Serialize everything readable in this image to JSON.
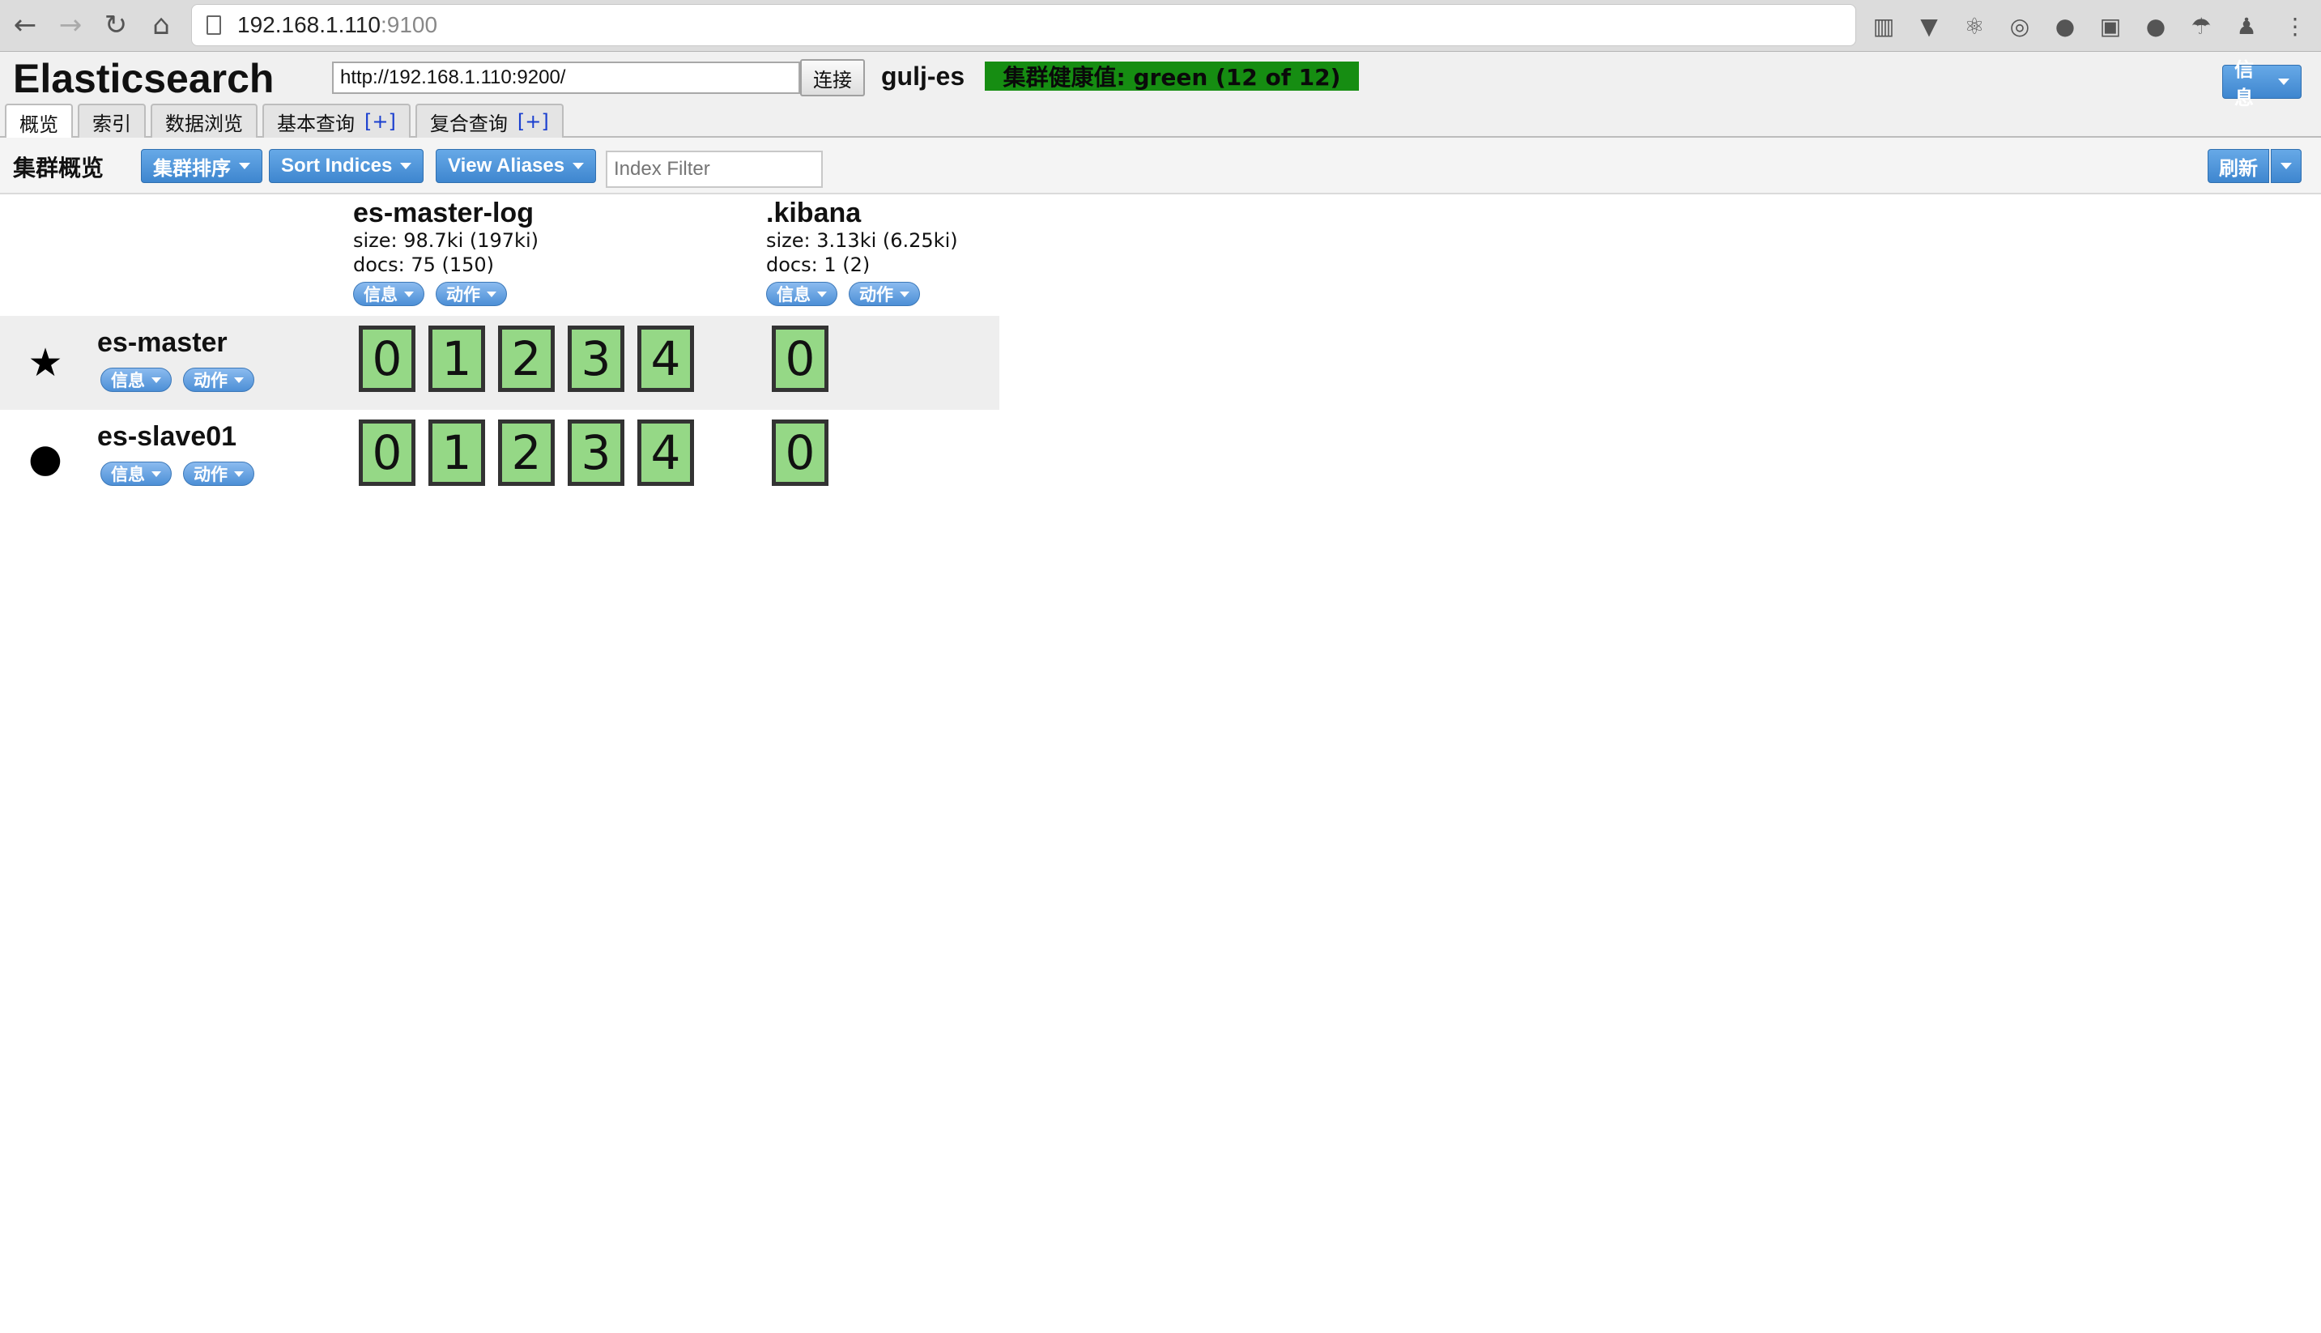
{
  "browser": {
    "url_host": "192.168.1.110",
    "url_port": ":9100"
  },
  "header": {
    "title": "Elasticsearch",
    "connect_url": "http://192.168.1.110:9200/",
    "connect_label": "连接",
    "cluster_name": "gulj-es",
    "health_text": "集群健康值: green (12 of 12)",
    "health_color": "#168d12",
    "info_label": "信息"
  },
  "tabs": [
    {
      "label": "概览",
      "plus": ""
    },
    {
      "label": "索引",
      "plus": ""
    },
    {
      "label": "数据浏览",
      "plus": ""
    },
    {
      "label": "基本查询",
      "plus": "[+]"
    },
    {
      "label": "复合查询",
      "plus": "[+]"
    }
  ],
  "toolbar": {
    "title": "集群概览",
    "sort_cluster": "集群排序",
    "sort_indices": "Sort Indices",
    "view_aliases": "View Aliases",
    "filter_placeholder": "Index Filter",
    "refresh": "刷新"
  },
  "indices": [
    {
      "name": "es-master-log",
      "size": "size: 98.7ki (197ki)",
      "docs": "docs: 75 (150)",
      "info": "信息",
      "action": "动作"
    },
    {
      "name": ".kibana",
      "size": "size: 3.13ki (6.25ki)",
      "docs": "docs: 1 (2)",
      "info": "信息",
      "action": "动作"
    }
  ],
  "nodes": [
    {
      "name": "es-master",
      "icon": "star-icon",
      "glyph": "★",
      "info": "信息",
      "action": "动作",
      "shards": {
        "es-master-log": [
          "0",
          "1",
          "2",
          "3",
          "4"
        ],
        ".kibana": [
          "0"
        ]
      }
    },
    {
      "name": "es-slave01",
      "icon": "circle-icon",
      "glyph": "●",
      "info": "信息",
      "action": "动作",
      "shards": {
        "es-master-log": [
          "0",
          "1",
          "2",
          "3",
          "4"
        ],
        ".kibana": [
          "0"
        ]
      }
    }
  ],
  "colors": {
    "shard_fill": "#95d886",
    "button_blue": "#4c8fd6"
  }
}
